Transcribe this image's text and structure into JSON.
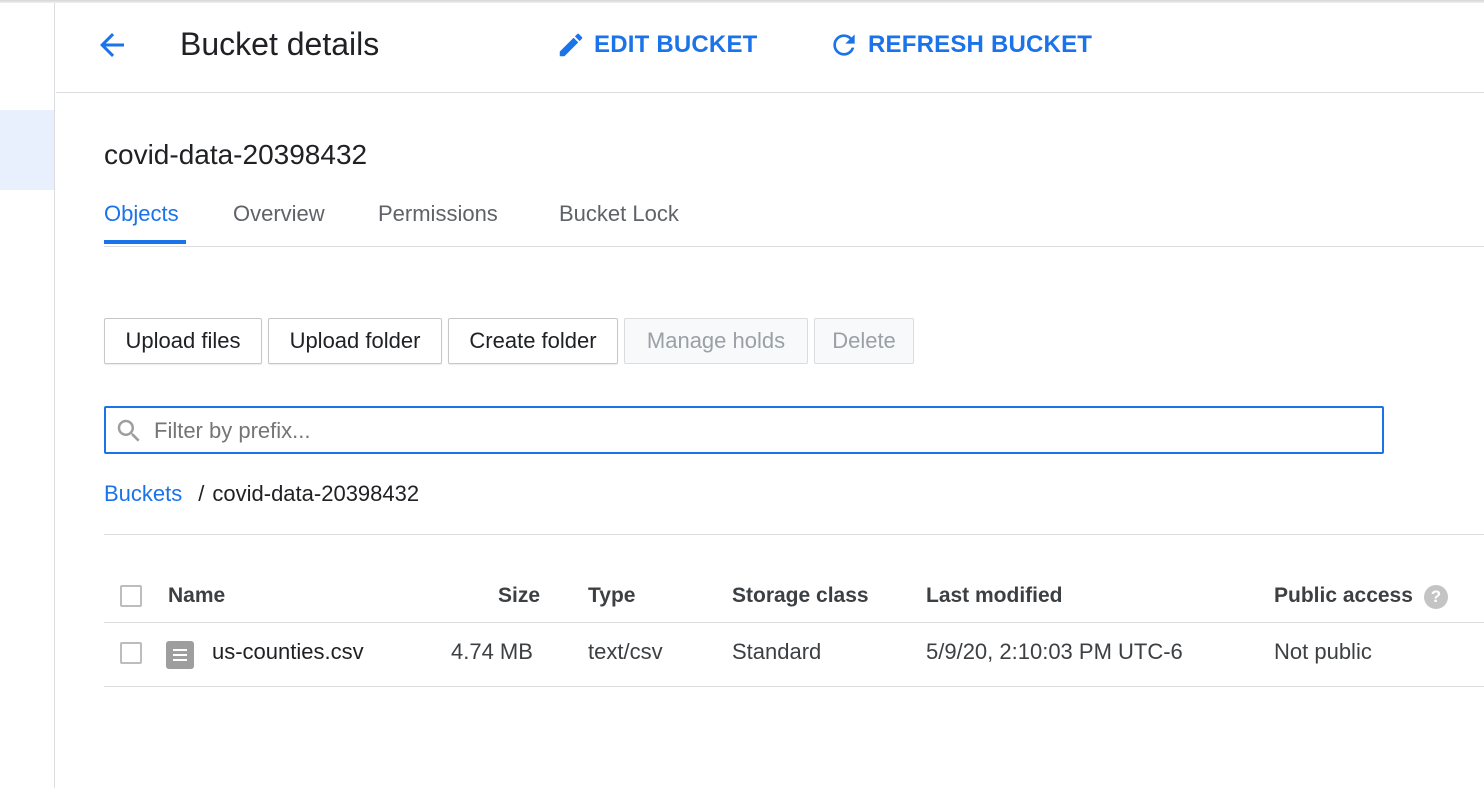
{
  "header": {
    "title": "Bucket details",
    "edit_label": "EDIT BUCKET",
    "refresh_label": "REFRESH BUCKET"
  },
  "bucket": {
    "name": "covid-data-20398432"
  },
  "tabs": [
    {
      "label": "Objects",
      "active": true
    },
    {
      "label": "Overview",
      "active": false
    },
    {
      "label": "Permissions",
      "active": false
    },
    {
      "label": "Bucket Lock",
      "active": false
    }
  ],
  "toolbar": {
    "upload_files": "Upload files",
    "upload_folder": "Upload folder",
    "create_folder": "Create folder",
    "manage_holds": "Manage holds",
    "delete": "Delete"
  },
  "filter": {
    "placeholder": "Filter by prefix...",
    "value": ""
  },
  "breadcrumb": {
    "root": "Buckets",
    "separator": "/",
    "current": "covid-data-20398432"
  },
  "table": {
    "columns": {
      "name": "Name",
      "size": "Size",
      "type": "Type",
      "storage_class": "Storage class",
      "last_modified": "Last modified",
      "public_access": "Public access"
    },
    "help_glyph": "?",
    "rows": [
      {
        "name": "us-counties.csv",
        "size": "4.74 MB",
        "type": "text/csv",
        "storage_class": "Standard",
        "last_modified": "5/9/20, 2:10:03 PM UTC-6",
        "public_access": "Not public"
      }
    ]
  },
  "colors": {
    "accent": "#1a73e8",
    "text": "#202124",
    "muted": "#5f6368",
    "disabled": "#9aa0a6",
    "divider": "#dadce0"
  },
  "icons": {
    "back": "arrow-left-icon",
    "edit": "pencil-icon",
    "refresh": "refresh-icon",
    "search": "search-icon",
    "file": "file-icon",
    "help": "help-icon"
  }
}
